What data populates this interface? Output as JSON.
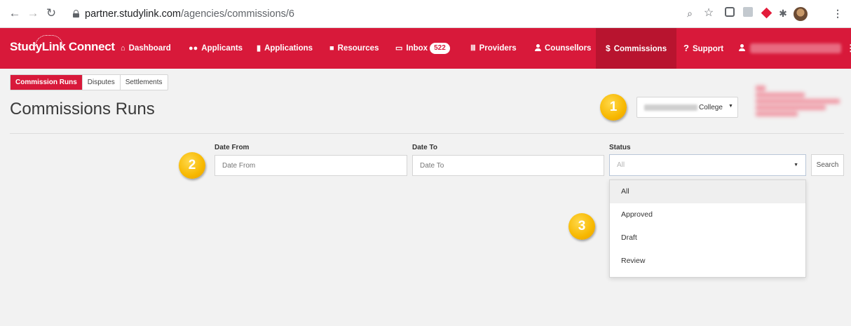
{
  "browser": {
    "url_host": "partner.studylink.com",
    "url_path": "/agencies/commissions/6",
    "icons": [
      "back-arrow-icon",
      "forward-arrow-icon",
      "reload-icon",
      "lock-icon",
      "zoom-icon",
      "star-icon",
      "extension-icon",
      "extension-icon",
      "extension-icon",
      "puzzle-icon",
      "profile-avatar",
      "kebab-menu-icon"
    ]
  },
  "brand": {
    "logo_text": "StudyLink Connect",
    "primary_color": "#d8193a",
    "active_color": "#b8142f"
  },
  "nav": {
    "items": [
      {
        "label": "Dashboard",
        "icon": "home-icon"
      },
      {
        "label": "Applicants",
        "icon": "users-icon"
      },
      {
        "label": "Applications",
        "icon": "file-icon"
      },
      {
        "label": "Resources",
        "icon": "folder-icon"
      },
      {
        "label": "Inbox",
        "icon": "inbox-icon",
        "badge": "522"
      },
      {
        "label": "Providers",
        "icon": "institution-icon"
      },
      {
        "label": "Counsellors",
        "icon": "user-icon"
      },
      {
        "label": "Commissions",
        "icon": "dollar-icon",
        "active": true
      },
      {
        "label": "Support",
        "icon": "question-icon"
      }
    ]
  },
  "tabs": [
    {
      "label": "Commission Runs",
      "active": true
    },
    {
      "label": "Disputes"
    },
    {
      "label": "Settlements"
    }
  ],
  "page": {
    "title": "Commissions Runs"
  },
  "college_select": {
    "value": "College"
  },
  "steps": [
    "1",
    "2",
    "3"
  ],
  "filters": {
    "date_from": {
      "label": "Date From",
      "placeholder": "Date From"
    },
    "date_to": {
      "label": "Date To",
      "placeholder": "Date To"
    },
    "status": {
      "label": "Status",
      "value": "All",
      "options": [
        "All",
        "Approved",
        "Draft",
        "Review"
      ]
    },
    "search_label": "Search"
  }
}
